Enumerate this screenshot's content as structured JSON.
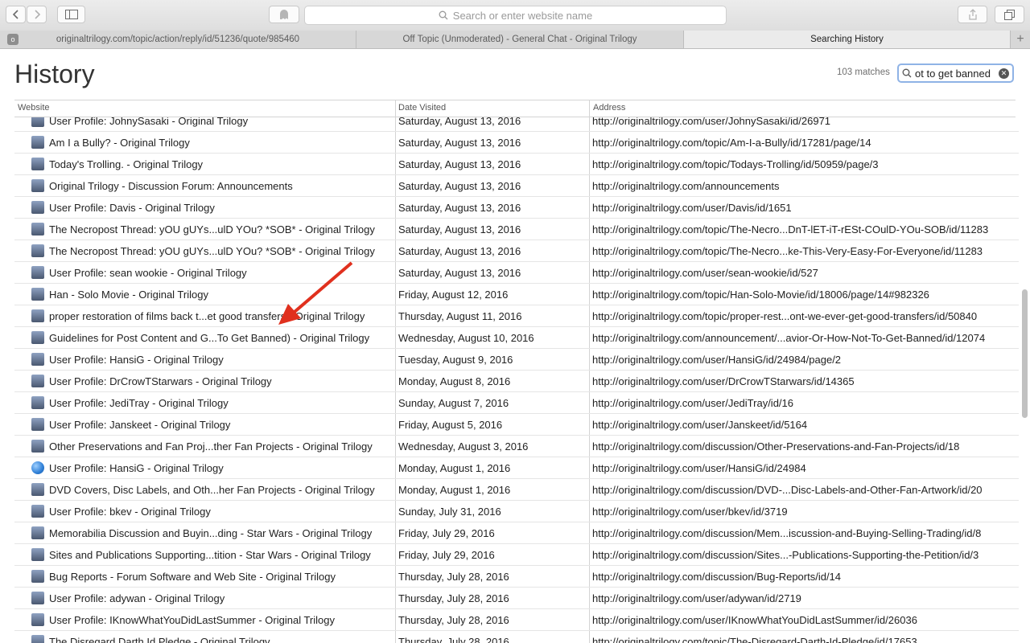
{
  "toolbar": {
    "search_placeholder": "Search or enter website name"
  },
  "tabs": [
    {
      "label": "originaltrilogy.com/topic/action/reply/id/51236/quote/985460"
    },
    {
      "label": "Off Topic (Unmoderated) - General Chat - Original Trilogy"
    },
    {
      "label": "Searching History"
    }
  ],
  "history": {
    "title": "History",
    "matches": "103 matches",
    "search_query": "ot to get banned",
    "columns": {
      "website": "Website",
      "date": "Date Visited",
      "address": "Address"
    },
    "rows": [
      {
        "site": "User Profile: JohnySasaki - Original Trilogy",
        "date": "Saturday, August 13, 2016",
        "address": "http://originaltrilogy.com/user/JohnySasaki/id/26971",
        "icon": "site-favicon"
      },
      {
        "site": "Am I a Bully? - Original Trilogy",
        "date": "Saturday, August 13, 2016",
        "address": "http://originaltrilogy.com/topic/Am-I-a-Bully/id/17281/page/14",
        "icon": "site-favicon"
      },
      {
        "site": "Today's Trolling. - Original Trilogy",
        "date": "Saturday, August 13, 2016",
        "address": "http://originaltrilogy.com/topic/Todays-Trolling/id/50959/page/3",
        "icon": "site-favicon"
      },
      {
        "site": "Original Trilogy - Discussion Forum: Announcements",
        "date": "Saturday, August 13, 2016",
        "address": "http://originaltrilogy.com/announcements",
        "icon": "site-favicon"
      },
      {
        "site": "User Profile: Davis - Original Trilogy",
        "date": "Saturday, August 13, 2016",
        "address": "http://originaltrilogy.com/user/Davis/id/1651",
        "icon": "site-favicon"
      },
      {
        "site": "The Necropost Thread: yOU gUYs...ulD YOu? *SOB* - Original Trilogy",
        "date": "Saturday, August 13, 2016",
        "address": "http://originaltrilogy.com/topic/The-Necro...DnT-lET-iT-rESt-COulD-YOu-SOB/id/11283",
        "icon": "site-favicon"
      },
      {
        "site": "The Necropost Thread: yOU gUYs...ulD YOu? *SOB* - Original Trilogy",
        "date": "Saturday, August 13, 2016",
        "address": "http://originaltrilogy.com/topic/The-Necro...ke-This-Very-Easy-For-Everyone/id/11283",
        "icon": "site-favicon"
      },
      {
        "site": "User Profile: sean wookie - Original Trilogy",
        "date": "Saturday, August 13, 2016",
        "address": "http://originaltrilogy.com/user/sean-wookie/id/527",
        "icon": "site-favicon"
      },
      {
        "site": "Han - Solo Movie - Original Trilogy",
        "date": "Friday, August 12, 2016",
        "address": "http://originaltrilogy.com/topic/Han-Solo-Movie/id/18006/page/14#982326",
        "icon": "site-favicon"
      },
      {
        "site": "proper restoration of films back t...et good transfers - Original Trilogy",
        "date": "Thursday, August 11, 2016",
        "address": "http://originaltrilogy.com/topic/proper-rest...ont-we-ever-get-good-transfers/id/50840",
        "icon": "site-favicon"
      },
      {
        "site": "Guidelines for Post Content and G...To Get Banned) - Original Trilogy",
        "date": "Wednesday, August 10, 2016",
        "address": "http://originaltrilogy.com/announcement/...avior-Or-How-Not-To-Get-Banned/id/12074",
        "icon": "site-favicon"
      },
      {
        "site": "User Profile: HansiG - Original Trilogy",
        "date": "Tuesday, August 9, 2016",
        "address": "http://originaltrilogy.com/user/HansiG/id/24984/page/2",
        "icon": "site-favicon"
      },
      {
        "site": "User Profile: DrCrowTStarwars - Original Trilogy",
        "date": "Monday, August 8, 2016",
        "address": "http://originaltrilogy.com/user/DrCrowTStarwars/id/14365",
        "icon": "site-favicon"
      },
      {
        "site": "User Profile: JediTray - Original Trilogy",
        "date": "Sunday, August 7, 2016",
        "address": "http://originaltrilogy.com/user/JediTray/id/16",
        "icon": "site-favicon"
      },
      {
        "site": "User Profile: Janskeet - Original Trilogy",
        "date": "Friday, August 5, 2016",
        "address": "http://originaltrilogy.com/user/Janskeet/id/5164",
        "icon": "site-favicon"
      },
      {
        "site": "Other Preservations and Fan Proj...ther Fan Projects - Original Trilogy",
        "date": "Wednesday, August 3, 2016",
        "address": "http://originaltrilogy.com/discussion/Other-Preservations-and-Fan-Projects/id/18",
        "icon": "site-favicon"
      },
      {
        "site": "User Profile: HansiG - Original Trilogy",
        "date": "Monday, August 1, 2016",
        "address": "http://originaltrilogy.com/user/HansiG/id/24984",
        "icon": "globe-icon"
      },
      {
        "site": "DVD Covers, Disc Labels, and Oth...her Fan Projects - Original Trilogy",
        "date": "Monday, August 1, 2016",
        "address": "http://originaltrilogy.com/discussion/DVD-...Disc-Labels-and-Other-Fan-Artwork/id/20",
        "icon": "site-favicon"
      },
      {
        "site": "User Profile: bkev - Original Trilogy",
        "date": "Sunday, July 31, 2016",
        "address": "http://originaltrilogy.com/user/bkev/id/3719",
        "icon": "site-favicon"
      },
      {
        "site": "Memorabilia Discussion and Buyin...ding - Star Wars - Original Trilogy",
        "date": "Friday, July 29, 2016",
        "address": "http://originaltrilogy.com/discussion/Mem...iscussion-and-Buying-Selling-Trading/id/8",
        "icon": "site-favicon"
      },
      {
        "site": "Sites and Publications Supporting...tition - Star Wars - Original Trilogy",
        "date": "Friday, July 29, 2016",
        "address": "http://originaltrilogy.com/discussion/Sites...-Publications-Supporting-the-Petition/id/3",
        "icon": "site-favicon"
      },
      {
        "site": "Bug Reports - Forum Software and Web Site - Original Trilogy",
        "date": "Thursday, July 28, 2016",
        "address": "http://originaltrilogy.com/discussion/Bug-Reports/id/14",
        "icon": "site-favicon"
      },
      {
        "site": "User Profile: adywan - Original Trilogy",
        "date": "Thursday, July 28, 2016",
        "address": "http://originaltrilogy.com/user/adywan/id/2719",
        "icon": "site-favicon"
      },
      {
        "site": "User Profile: IKnowWhatYouDidLastSummer - Original Trilogy",
        "date": "Thursday, July 28, 2016",
        "address": "http://originaltrilogy.com/user/IKnowWhatYouDidLastSummer/id/26036",
        "icon": "site-favicon"
      },
      {
        "site": "The Disregard Darth Id Pledge - Original Trilogy",
        "date": "Thursday, July 28, 2016",
        "address": "http://originaltrilogy.com/topic/The-Disregard-Darth-Id-Pledge/id/17653",
        "icon": "site-favicon"
      }
    ]
  },
  "annotation": {
    "color": "#e0301e"
  },
  "colors": {
    "search_focus": "#8fb3e6",
    "active_tab": "#ebebeb"
  }
}
